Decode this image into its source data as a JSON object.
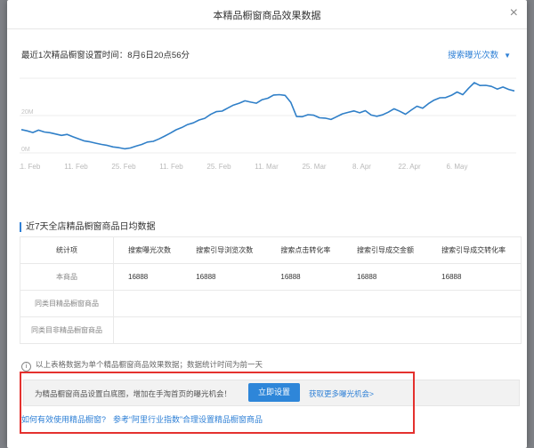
{
  "modal": {
    "title": "本精品橱窗商品效果数据",
    "close_icon": "×"
  },
  "setting": {
    "last_set_time": "最近1次精品橱窗设置时间：8月6日20点56分",
    "metric_label": "搜索曝光次数",
    "metric_caret": "▼"
  },
  "chart_data": {
    "type": "line",
    "x": [
      "11. Feb",
      "11. Feb",
      "25. Feb",
      "11. Feb",
      "25. Feb",
      "11. Mar",
      "25. Mar",
      "8. Apr",
      "22. Apr",
      "6. May"
    ],
    "y_ticks": [
      "0M",
      "20M"
    ],
    "series": [
      {
        "color": "#2f7fc8",
        "values": [
          12.5,
          11.8,
          10.9,
          12.2,
          11.2,
          10.8,
          10.1,
          9.4,
          9.9,
          8.6,
          7.5,
          6.4,
          5.9,
          5.2,
          4.5,
          4.0,
          3.2,
          2.8,
          2.2,
          2.6,
          3.6,
          4.5,
          5.8,
          6.2,
          7.5,
          9.0,
          10.6,
          12.4,
          13.6,
          15.2,
          16.1,
          17.6,
          18.5,
          20.6,
          22.1,
          22.4,
          24.0,
          25.6,
          26.6,
          27.9,
          27.2,
          26.6,
          28.5,
          29.3,
          31.0,
          31.2,
          30.8,
          27.0,
          19.5,
          19.4,
          20.5,
          20.2,
          18.8,
          18.6,
          17.9,
          19.4,
          20.9,
          21.7,
          22.5,
          21.5,
          22.6,
          20.3,
          19.6,
          20.4,
          21.8,
          23.6,
          22.3,
          20.7,
          22.9,
          25.0,
          23.9,
          26.4,
          28.3,
          29.5,
          29.6,
          30.8,
          32.6,
          31.2,
          34.6,
          37.6,
          36.1,
          36.2,
          35.6,
          34.2,
          35.3,
          34.0,
          33.2
        ]
      }
    ],
    "ylim": [
      0,
      40
    ],
    "grid": true
  },
  "section": {
    "title": "近7天全店精品橱窗商品日均数据"
  },
  "table": {
    "columns": [
      "统计项",
      "搜索曝光次数",
      "搜索引导浏览次数",
      "搜索点击转化率",
      "搜索引导成交金额",
      "搜索引导成交转化率"
    ],
    "rows": [
      {
        "label": "本商品",
        "cells": [
          "16888",
          "16888",
          "16888",
          "16888",
          "16888"
        ]
      },
      {
        "label": "同类目精品橱窗商品",
        "cells": [
          "",
          "",
          "",
          "",
          ""
        ]
      },
      {
        "label": "同类目非精品橱窗商品",
        "cells": [
          "",
          "",
          "",
          "",
          ""
        ]
      }
    ]
  },
  "note": {
    "icon": "i",
    "text": "以上表格数据为单个精品橱窗商品效果数据；数据统计时间为前一天"
  },
  "tip": {
    "text": "为精品橱窗商品设置白底图，增加在手淘首页的曝光机会！",
    "button": "立即设置",
    "link": "获取更多曝光机会>"
  },
  "links": {
    "how_to": "如何有效使用精品橱窗?",
    "refer": "参考“阿里行业指数”合理设置精品橱窗商品"
  }
}
